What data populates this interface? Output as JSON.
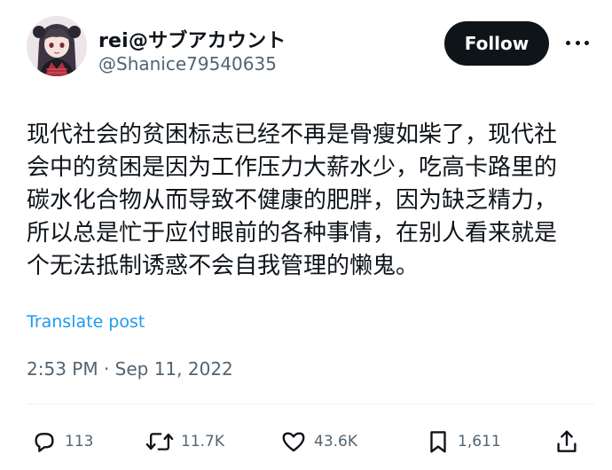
{
  "author": {
    "display_name": "rei@サブアカウント",
    "handle": "@Shanice79540635"
  },
  "follow_button": {
    "label": "Follow"
  },
  "more_icon": "ellipsis-horizontal",
  "tweet": {
    "lines": [
      "现代社会的贫困标志已经不再是骨瘦如柴了，现代社",
      "会中的贫困是因为工作压力大薪水少，吃高卡路里的",
      "碳水化合物从而导致不健康的肥胖，因为缺乏精力，",
      "所以总是忙于应付眼前的各种事情，在别人看来就是",
      "个无法抵制诱惑不会自我管理的懒鬼。"
    ],
    "translate_label": "Translate post",
    "timestamp": "2:53 PM · Sep 11, 2022"
  },
  "actions": {
    "reply": {
      "icon": "reply-icon",
      "count": "113"
    },
    "retweet": {
      "icon": "retweet-icon",
      "count": "11.7K"
    },
    "like": {
      "icon": "heart-icon",
      "count": "43.6K"
    },
    "bookmark": {
      "icon": "bookmark-icon",
      "count": "1,611"
    },
    "share": {
      "icon": "share-icon"
    }
  },
  "colors": {
    "text": "#0f1419",
    "secondary": "#536471",
    "link": "#1d9bf0",
    "button_bg": "#0f1419",
    "button_text": "#ffffff"
  }
}
